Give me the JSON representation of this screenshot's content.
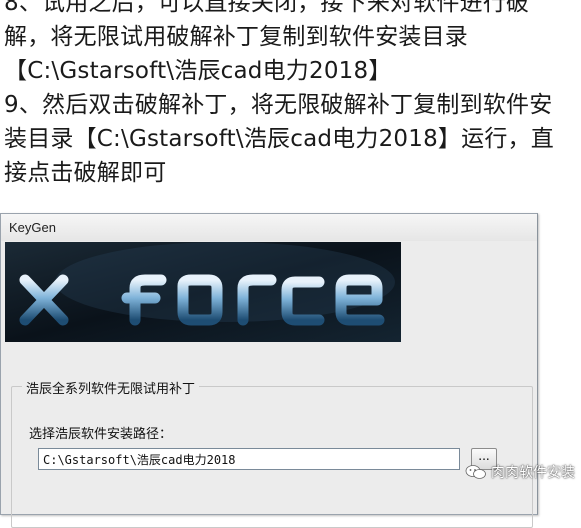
{
  "article": {
    "lines": [
      "8、试用之后，可以直接关闭，接下来对软件进行破",
      "解，将无限试用破解补丁复制到软件安装目录",
      "【C:\\Gstarsoft\\浩辰cad电力2018】",
      "9、然后双击破解补丁，将无限破解补丁复制到软件安",
      "装目录【C:\\Gstarsoft\\浩辰cad电力2018】运行，直",
      "接点击破解即可"
    ]
  },
  "dialog": {
    "title": "KeyGen",
    "banner_logo": "X-FORCE",
    "group_title": "浩辰全系列软件无限试用补丁",
    "path_label": "选择浩辰软件安装路径：",
    "path_value": "C:\\Gstarsoft\\浩辰cad电力2018",
    "browse_label": "..."
  },
  "watermark": {
    "text": "肉肉软件安装",
    "icon": "wechat-icon"
  }
}
